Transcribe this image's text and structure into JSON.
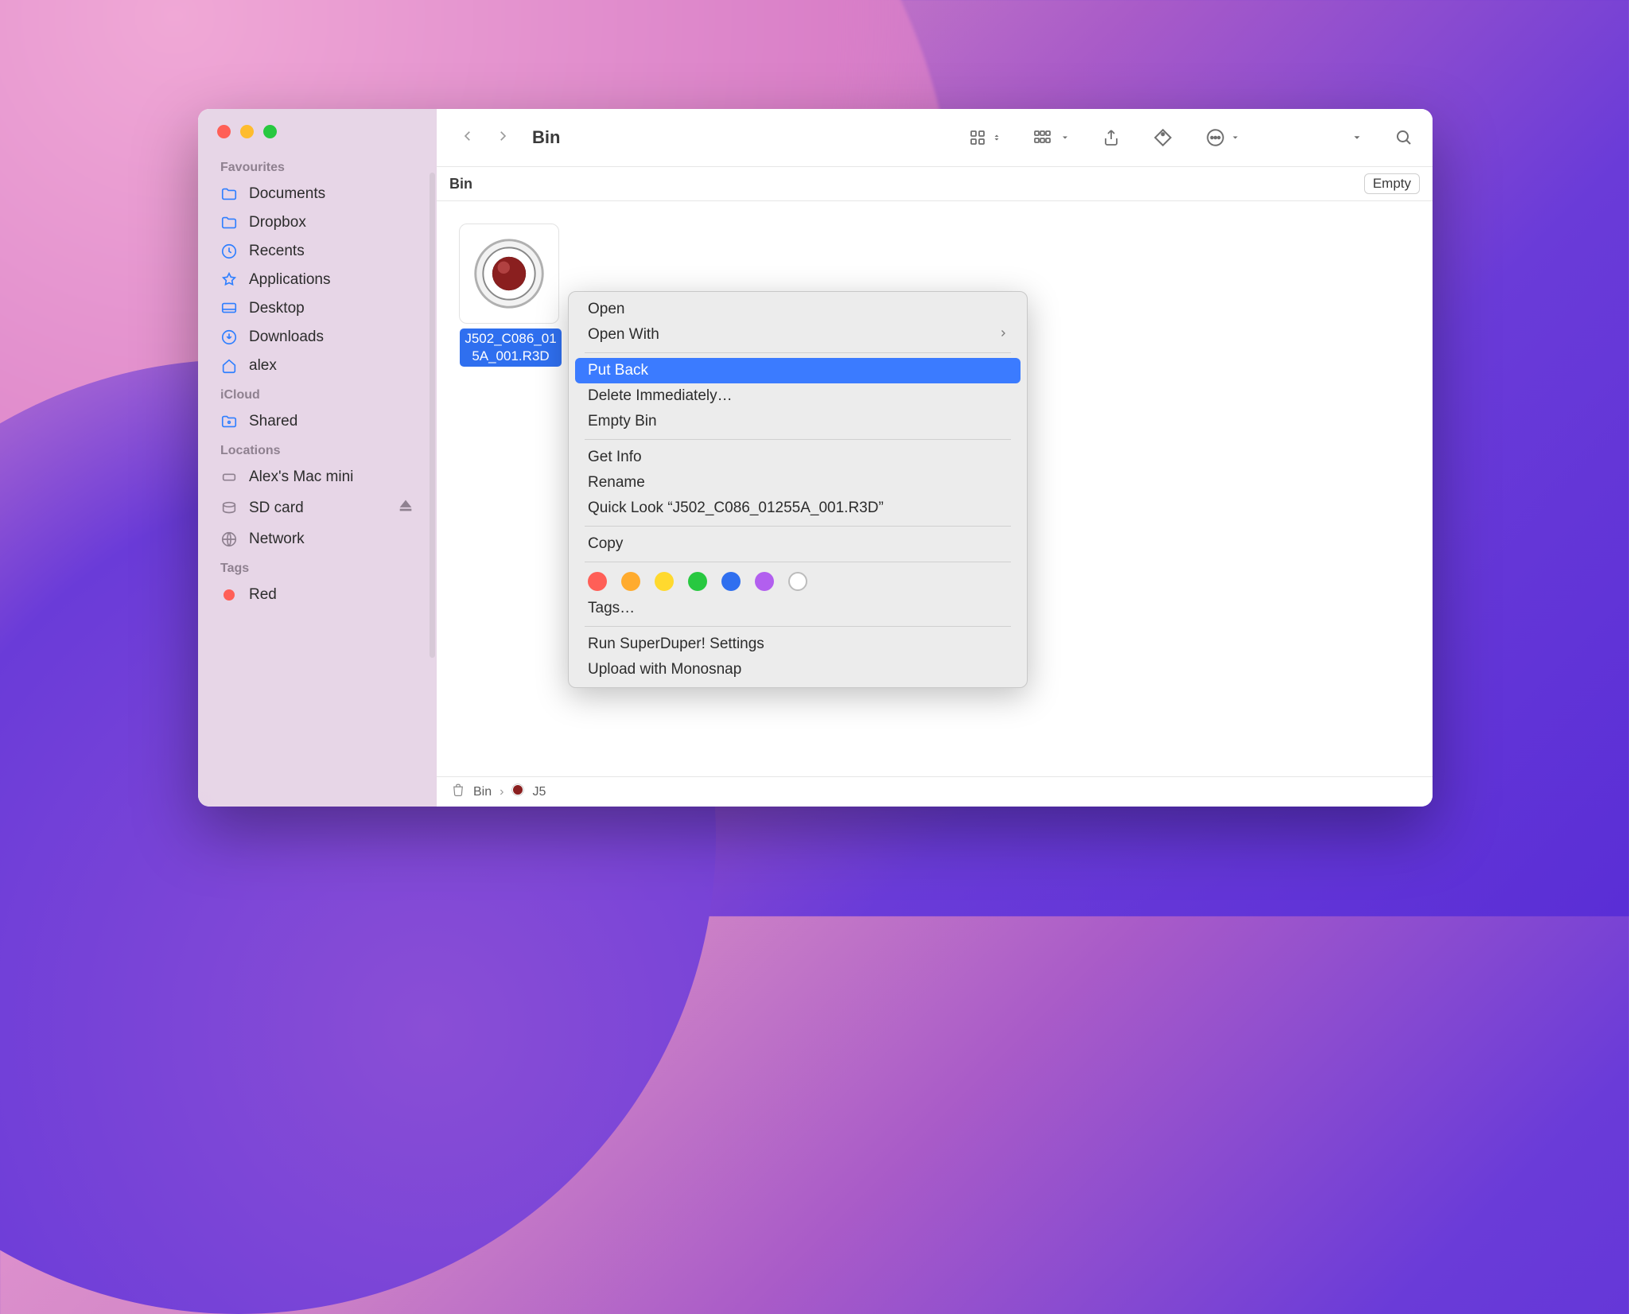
{
  "window": {
    "title": "Bin",
    "row_header": "Bin",
    "empty_button": "Empty"
  },
  "sidebar": {
    "sections": {
      "favourites": "Favourites",
      "icloud": "iCloud",
      "locations": "Locations",
      "tags": "Tags"
    },
    "favourites": [
      {
        "label": "Documents"
      },
      {
        "label": "Dropbox"
      },
      {
        "label": "Recents"
      },
      {
        "label": "Applications"
      },
      {
        "label": "Desktop"
      },
      {
        "label": "Downloads"
      },
      {
        "label": "alex"
      }
    ],
    "icloud": [
      {
        "label": "Shared"
      }
    ],
    "locations": [
      {
        "label": "Alex's Mac mini"
      },
      {
        "label": "SD card"
      },
      {
        "label": "Network"
      }
    ],
    "tags": [
      {
        "label": "Red",
        "color": "#ff5f57"
      }
    ]
  },
  "file": {
    "name_line1": "J502_C086_01",
    "name_line2": "5A_001.R3D"
  },
  "context_menu": {
    "open": "Open",
    "open_with": "Open With",
    "put_back": "Put Back",
    "delete_immediately": "Delete Immediately…",
    "empty_bin": "Empty Bin",
    "get_info": "Get Info",
    "rename": "Rename",
    "quick_look": "Quick Look “J502_C086_01255A_001.R3D”",
    "copy": "Copy",
    "tags": "Tags…",
    "superduper": "Run SuperDuper! Settings",
    "monosnap": "Upload with Monosnap",
    "tag_colors": [
      "#ff5f57",
      "#ffab2e",
      "#ffd92e",
      "#28c840",
      "#2f6fef",
      "#b25fef"
    ]
  },
  "pathbar": {
    "bin": "Bin",
    "file_short": "J5"
  }
}
